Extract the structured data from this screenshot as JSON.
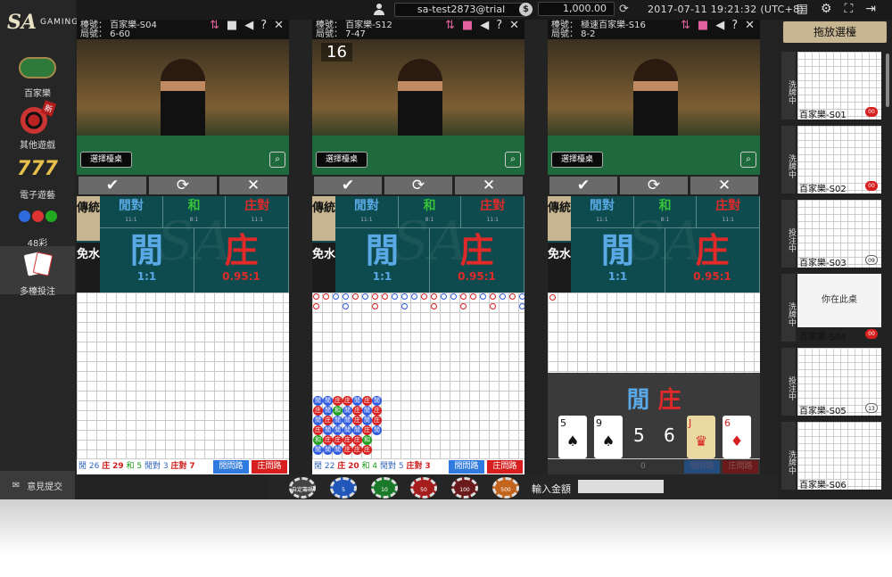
{
  "brand": {
    "logo": "SA",
    "sub": "GAMING"
  },
  "topbar": {
    "username": "sa-test2873@trial",
    "balance": "1,000.00",
    "datetime": "2017-07-11   19:21:32   (UTC+8)"
  },
  "nav": [
    {
      "label": "百家樂"
    },
    {
      "label": "其他遊戲",
      "badge": "新"
    },
    {
      "label": "電子遊藝"
    },
    {
      "label": "48彩"
    },
    {
      "label": "多檯投注"
    }
  ],
  "feedback": "意見提交",
  "panels": [
    {
      "line1": "檯號：  百家樂-S04",
      "line2": "局號：  6-60",
      "countdown": "",
      "choose": "選擇檯桌",
      "stats": {
        "banker_label": "閒",
        "p_count": "26",
        "b_label": "庄",
        "b_count": "29",
        "tie_label": "和",
        "tie_count": "5",
        "pp_label": "閒對",
        "pp_count": "3",
        "bp_label": "庄對",
        "bp_count": "7"
      },
      "btn_player": "閒問路",
      "btn_banker": "庄問路"
    },
    {
      "line1": "檯號：  百家樂-S12",
      "line2": "局號：  7-47",
      "countdown": "16",
      "choose": "選擇檯桌",
      "stats": {
        "banker_label": "閒",
        "p_count": "22",
        "b_label": "庄",
        "b_count": "20",
        "tie_label": "和",
        "tie_count": "4",
        "pp_label": "閒對",
        "pp_count": "5",
        "bp_label": "庄對",
        "bp_count": "3"
      },
      "btn_player": "閒問路",
      "btn_banker": "庄問路"
    },
    {
      "line1": "檯號：  極速百家樂-S16",
      "line2": "局號：  8-2",
      "countdown": "",
      "choose": "選擇檯桌",
      "stats": {
        "banker_label": "閒",
        "p_count": "",
        "b_label": "",
        "b_count": "0",
        "tie_label": "",
        "tie_count": "",
        "pp_label": "",
        "pp_count": "",
        "bp_label": "",
        "bp_count": ""
      },
      "btn_player": "閒問路",
      "btn_banker": "庄問路",
      "result": {
        "title_player": "閒",
        "title_banker": "庄",
        "player_score": "5",
        "banker_score": "6"
      }
    }
  ],
  "bet": {
    "tab_trad": "傳統",
    "tab_nocomm": "免水",
    "player_pair": "閒對",
    "pair_odds": "11:1",
    "tie": "和",
    "tie_odds": "8:1",
    "banker_pair": "庄對",
    "player": "閒",
    "player_odds": "1:1",
    "banker": "庄",
    "banker_odds": "0.95:1"
  },
  "cards": {
    "p1": "5",
    "p2": "9",
    "b1": "J",
    "b2": "6"
  },
  "right": {
    "button": "拖放選檯",
    "here": "你在此桌",
    "tables": [
      {
        "status": "洗牌中",
        "name": "百家樂-S01",
        "badge": "00"
      },
      {
        "status": "洗牌中",
        "name": "百家樂-S02",
        "badge": "00"
      },
      {
        "status": "投注中",
        "name": "百家樂-S03",
        "badge": "09"
      },
      {
        "status": "洗牌中",
        "name": "百家樂-S04",
        "badge": "00"
      },
      {
        "status": "投注中",
        "name": "百家樂-S05",
        "badge": "13"
      },
      {
        "status": "洗牌中",
        "name": "百家樂-S06",
        "badge": ""
      }
    ]
  },
  "chips": [
    "自定籌碼",
    "5",
    "10",
    "50",
    "100",
    "500"
  ],
  "amount_label": "輸入金額",
  "colors": {
    "player": "#5aa9e6",
    "banker": "#e02a2a",
    "tie": "#37c337",
    "felt": "#1f6a3c",
    "betbg": "#0d4b4e",
    "gold": "#c8b591"
  }
}
